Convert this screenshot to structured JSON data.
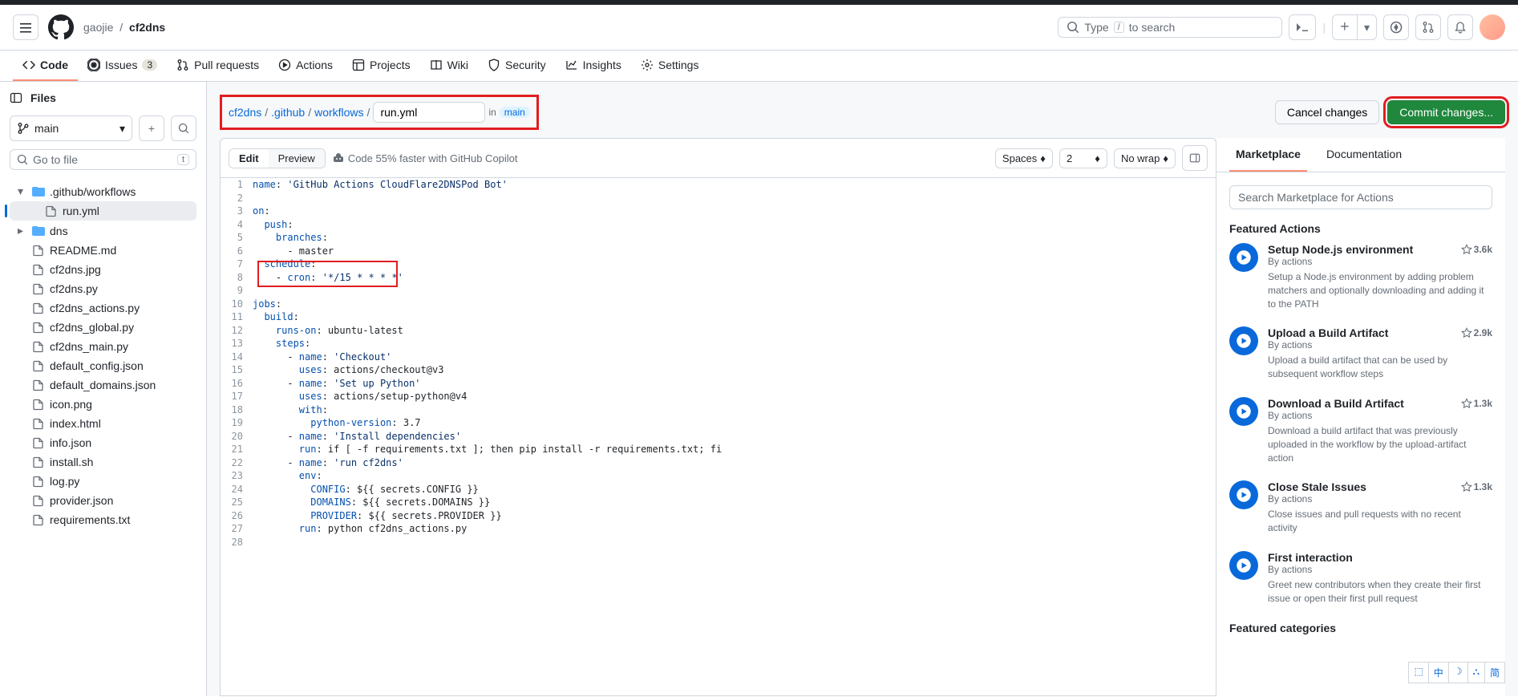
{
  "top": {
    "owner": "gaojie",
    "repo": "cf2dns",
    "search_placeholder": "Type",
    "search_hint": "to search",
    "slash_key": "/"
  },
  "tabs": {
    "code": "Code",
    "issues": "Issues",
    "issues_count": "3",
    "pulls": "Pull requests",
    "actions": "Actions",
    "projects": "Projects",
    "wiki": "Wiki",
    "security": "Security",
    "insights": "Insights",
    "settings": "Settings"
  },
  "sidebar": {
    "title": "Files",
    "branch": "main",
    "goto_placeholder": "Go to file",
    "goto_key": "t",
    "tree": [
      {
        "name": ".github/workflows",
        "type": "folder",
        "open": true,
        "depth": 0
      },
      {
        "name": "run.yml",
        "type": "file",
        "active": true,
        "depth": 1
      },
      {
        "name": "dns",
        "type": "folder",
        "open": false,
        "depth": 0
      },
      {
        "name": "README.md",
        "type": "file",
        "depth": 0
      },
      {
        "name": "cf2dns.jpg",
        "type": "file",
        "depth": 0
      },
      {
        "name": "cf2dns.py",
        "type": "file",
        "depth": 0
      },
      {
        "name": "cf2dns_actions.py",
        "type": "file",
        "depth": 0
      },
      {
        "name": "cf2dns_global.py",
        "type": "file",
        "depth": 0
      },
      {
        "name": "cf2dns_main.py",
        "type": "file",
        "depth": 0
      },
      {
        "name": "default_config.json",
        "type": "file",
        "depth": 0
      },
      {
        "name": "default_domains.json",
        "type": "file",
        "depth": 0
      },
      {
        "name": "icon.png",
        "type": "file",
        "depth": 0
      },
      {
        "name": "index.html",
        "type": "file",
        "depth": 0
      },
      {
        "name": "info.json",
        "type": "file",
        "depth": 0
      },
      {
        "name": "install.sh",
        "type": "file",
        "depth": 0
      },
      {
        "name": "log.py",
        "type": "file",
        "depth": 0
      },
      {
        "name": "provider.json",
        "type": "file",
        "depth": 0
      },
      {
        "name": "requirements.txt",
        "type": "file",
        "depth": 0
      }
    ]
  },
  "path": {
    "seg0": "cf2dns",
    "seg1": ".github",
    "seg2": "workflows",
    "filename": "run.yml",
    "in_text": "in",
    "branch": "main"
  },
  "header_buttons": {
    "cancel": "Cancel changes",
    "commit": "Commit changes..."
  },
  "editor_toolbar": {
    "edit": "Edit",
    "preview": "Preview",
    "copilot": "Code 55% faster with GitHub Copilot",
    "indent": "Spaces",
    "indent_size": "2",
    "wrap": "No wrap"
  },
  "code_lines": [
    "name: 'GitHub Actions CloudFlare2DNSPod Bot'",
    "",
    "on:",
    "  push:",
    "    branches:",
    "      - master",
    "  schedule:",
    "    - cron: '*/15 * * * *'",
    "",
    "jobs:",
    "  build:",
    "    runs-on: ubuntu-latest",
    "    steps:",
    "      - name: 'Checkout'",
    "        uses: actions/checkout@v3",
    "      - name: 'Set up Python'",
    "        uses: actions/setup-python@v4",
    "        with:",
    "          python-version: 3.7",
    "      - name: 'Install dependencies'",
    "        run: if [ -f requirements.txt ]; then pip install -r requirements.txt; fi",
    "      - name: 'run cf2dns'",
    "        env:",
    "          CONFIG: ${{ secrets.CONFIG }}",
    "          DOMAINS: ${{ secrets.DOMAINS }}",
    "          PROVIDER: ${{ secrets.PROVIDER }}",
    "        run: python cf2dns_actions.py",
    ""
  ],
  "marketplace": {
    "tab1": "Marketplace",
    "tab2": "Documentation",
    "search_placeholder": "Search Marketplace for Actions",
    "featured_title": "Featured Actions",
    "categories_title": "Featured categories",
    "actions": [
      {
        "title": "Setup Node.js environment",
        "author": "By actions",
        "stars": "3.6k",
        "desc": "Setup a Node.js environment by adding problem matchers and optionally downloading and adding it to the PATH"
      },
      {
        "title": "Upload a Build Artifact",
        "author": "By actions",
        "stars": "2.9k",
        "desc": "Upload a build artifact that can be used by subsequent workflow steps"
      },
      {
        "title": "Download a Build Artifact",
        "author": "By actions",
        "stars": "1.3k",
        "desc": "Download a build artifact that was previously uploaded in the workflow by the upload-artifact action"
      },
      {
        "title": "Close Stale Issues",
        "author": "By actions",
        "stars": "1.3k",
        "desc": "Close issues and pull requests with no recent activity"
      },
      {
        "title": "First interaction",
        "author": "By actions",
        "stars": "",
        "desc": "Greet new contributors when they create their first issue or open their first pull request"
      }
    ]
  },
  "lang_bar": {
    "items": [
      "⬚",
      "中",
      "☽",
      "⛬",
      "简"
    ]
  }
}
